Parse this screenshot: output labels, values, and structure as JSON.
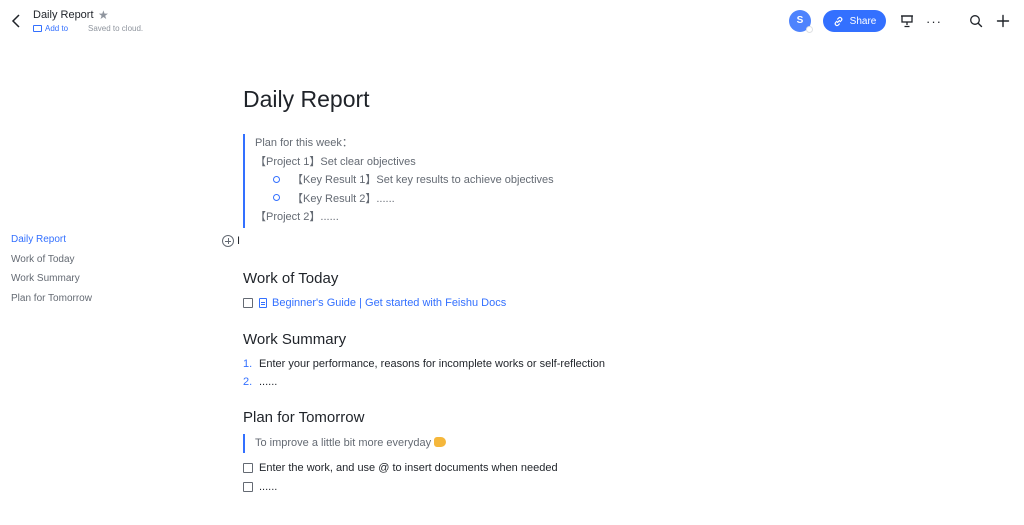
{
  "header": {
    "title": "Daily Report",
    "add_to": "Add to",
    "save_status": "Saved to cloud.",
    "avatar_initial": "S",
    "share_label": "Share",
    "more_label": "···"
  },
  "outline": {
    "items": [
      {
        "label": "Daily Report",
        "active": true
      },
      {
        "label": "Work of Today",
        "active": false
      },
      {
        "label": "Work Summary",
        "active": false
      },
      {
        "label": "Plan for Tomorrow",
        "active": false
      }
    ]
  },
  "doc": {
    "title": "Daily Report",
    "plan_quote": {
      "lines": [
        "Plan for this week：",
        "【Project 1】Set clear objectives",
        "【Key Result 1】Set key results to achieve objectives",
        "【Key Result 2】......",
        "【Project 2】......"
      ]
    },
    "cursor": "I",
    "work_today": {
      "heading": "Work of Today",
      "link_text": "Beginner's Guide | Get started with Feishu Docs"
    },
    "work_summary": {
      "heading": "Work Summary",
      "items": [
        {
          "num": "1.",
          "text": "Enter your performance, reasons for incomplete works or self-reflection"
        },
        {
          "num": "2.",
          "text": "......"
        }
      ]
    },
    "plan_tomorrow": {
      "heading": "Plan for Tomorrow",
      "quote": "To improve a little bit more everyday",
      "todos": [
        "Enter the work, and use @ to insert documents when needed",
        "......"
      ]
    }
  },
  "colors": {
    "accent": "#3370ff",
    "text": "#1f2329",
    "muted": "#646a73"
  }
}
